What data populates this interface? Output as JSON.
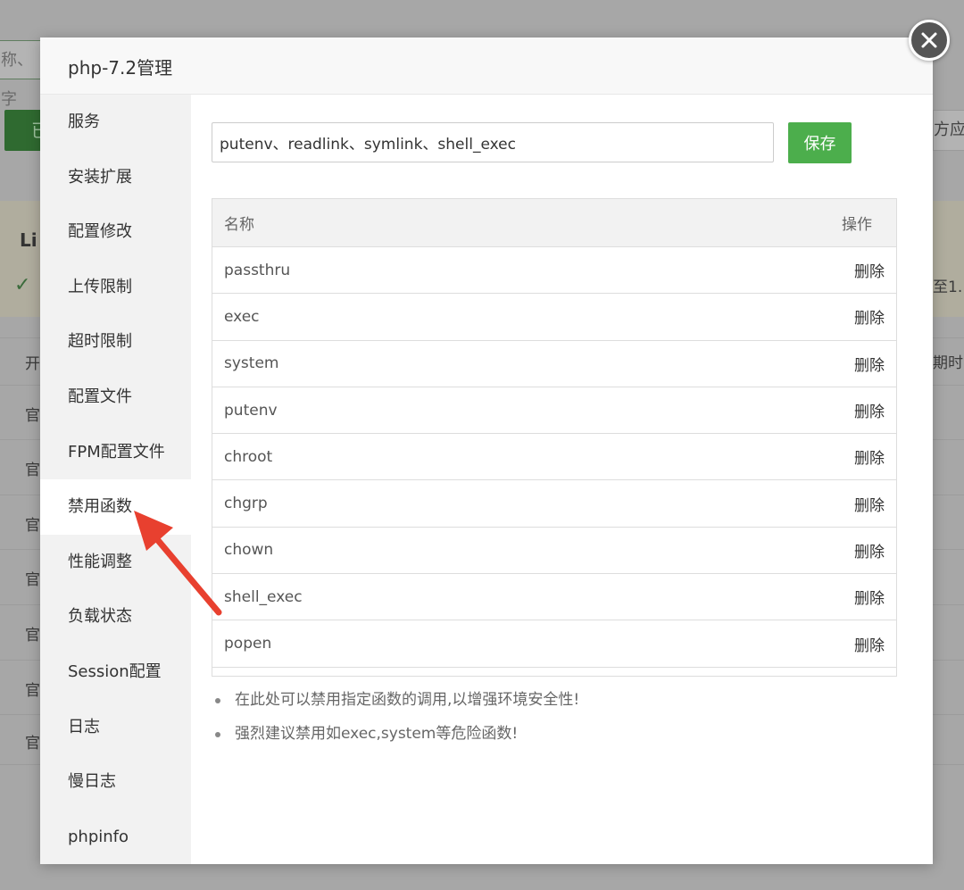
{
  "background": {
    "search_placeholder": "称、字",
    "green_button_label": "已",
    "right_button_label": "方应",
    "notice_title": "Li",
    "notice_right_text": "至1.",
    "check_symbol": "✓",
    "column_header_left": "开",
    "column_header_right": "期时",
    "row_labels": [
      "官",
      "官",
      "官",
      "官",
      "官",
      "官",
      "官"
    ]
  },
  "modal": {
    "title": "php-7.2管理",
    "close_icon": "close-x-icon"
  },
  "sidebar": {
    "items": [
      {
        "label": "服务"
      },
      {
        "label": "安装扩展"
      },
      {
        "label": "配置修改"
      },
      {
        "label": "上传限制"
      },
      {
        "label": "超时限制"
      },
      {
        "label": "配置文件"
      },
      {
        "label": "FPM配置文件"
      },
      {
        "label": "禁用函数",
        "active": true
      },
      {
        "label": "性能调整"
      },
      {
        "label": "负载状态"
      },
      {
        "label": "Session配置"
      },
      {
        "label": "日志"
      },
      {
        "label": "慢日志"
      },
      {
        "label": "phpinfo"
      }
    ]
  },
  "disabled_functions": {
    "input_value": "putenv、readlink、symlink、shell_exec",
    "save_label": "保存",
    "columns": {
      "name": "名称",
      "action": "操作"
    },
    "rows": [
      {
        "name": "passthru",
        "action": "删除"
      },
      {
        "name": "exec",
        "action": "删除"
      },
      {
        "name": "system",
        "action": "删除"
      },
      {
        "name": "putenv",
        "action": "删除"
      },
      {
        "name": "chroot",
        "action": "删除"
      },
      {
        "name": "chgrp",
        "action": "删除"
      },
      {
        "name": "chown",
        "action": "删除"
      },
      {
        "name": "shell_exec",
        "action": "删除"
      },
      {
        "name": "popen",
        "action": "删除"
      },
      {
        "name": "",
        "action": ""
      }
    ],
    "tips": [
      "在此处可以禁用指定函数的调用,以增强环境安全性!",
      "强烈建议禁用如exec,system等危险函数!"
    ]
  },
  "annotation": {
    "arrow_icon": "red-arrow-icon",
    "color": "#e8402f"
  },
  "colors": {
    "save_button": "#4cae4c",
    "sidebar_bg": "#f2f2f2",
    "overlay": "#a7a7a7"
  }
}
